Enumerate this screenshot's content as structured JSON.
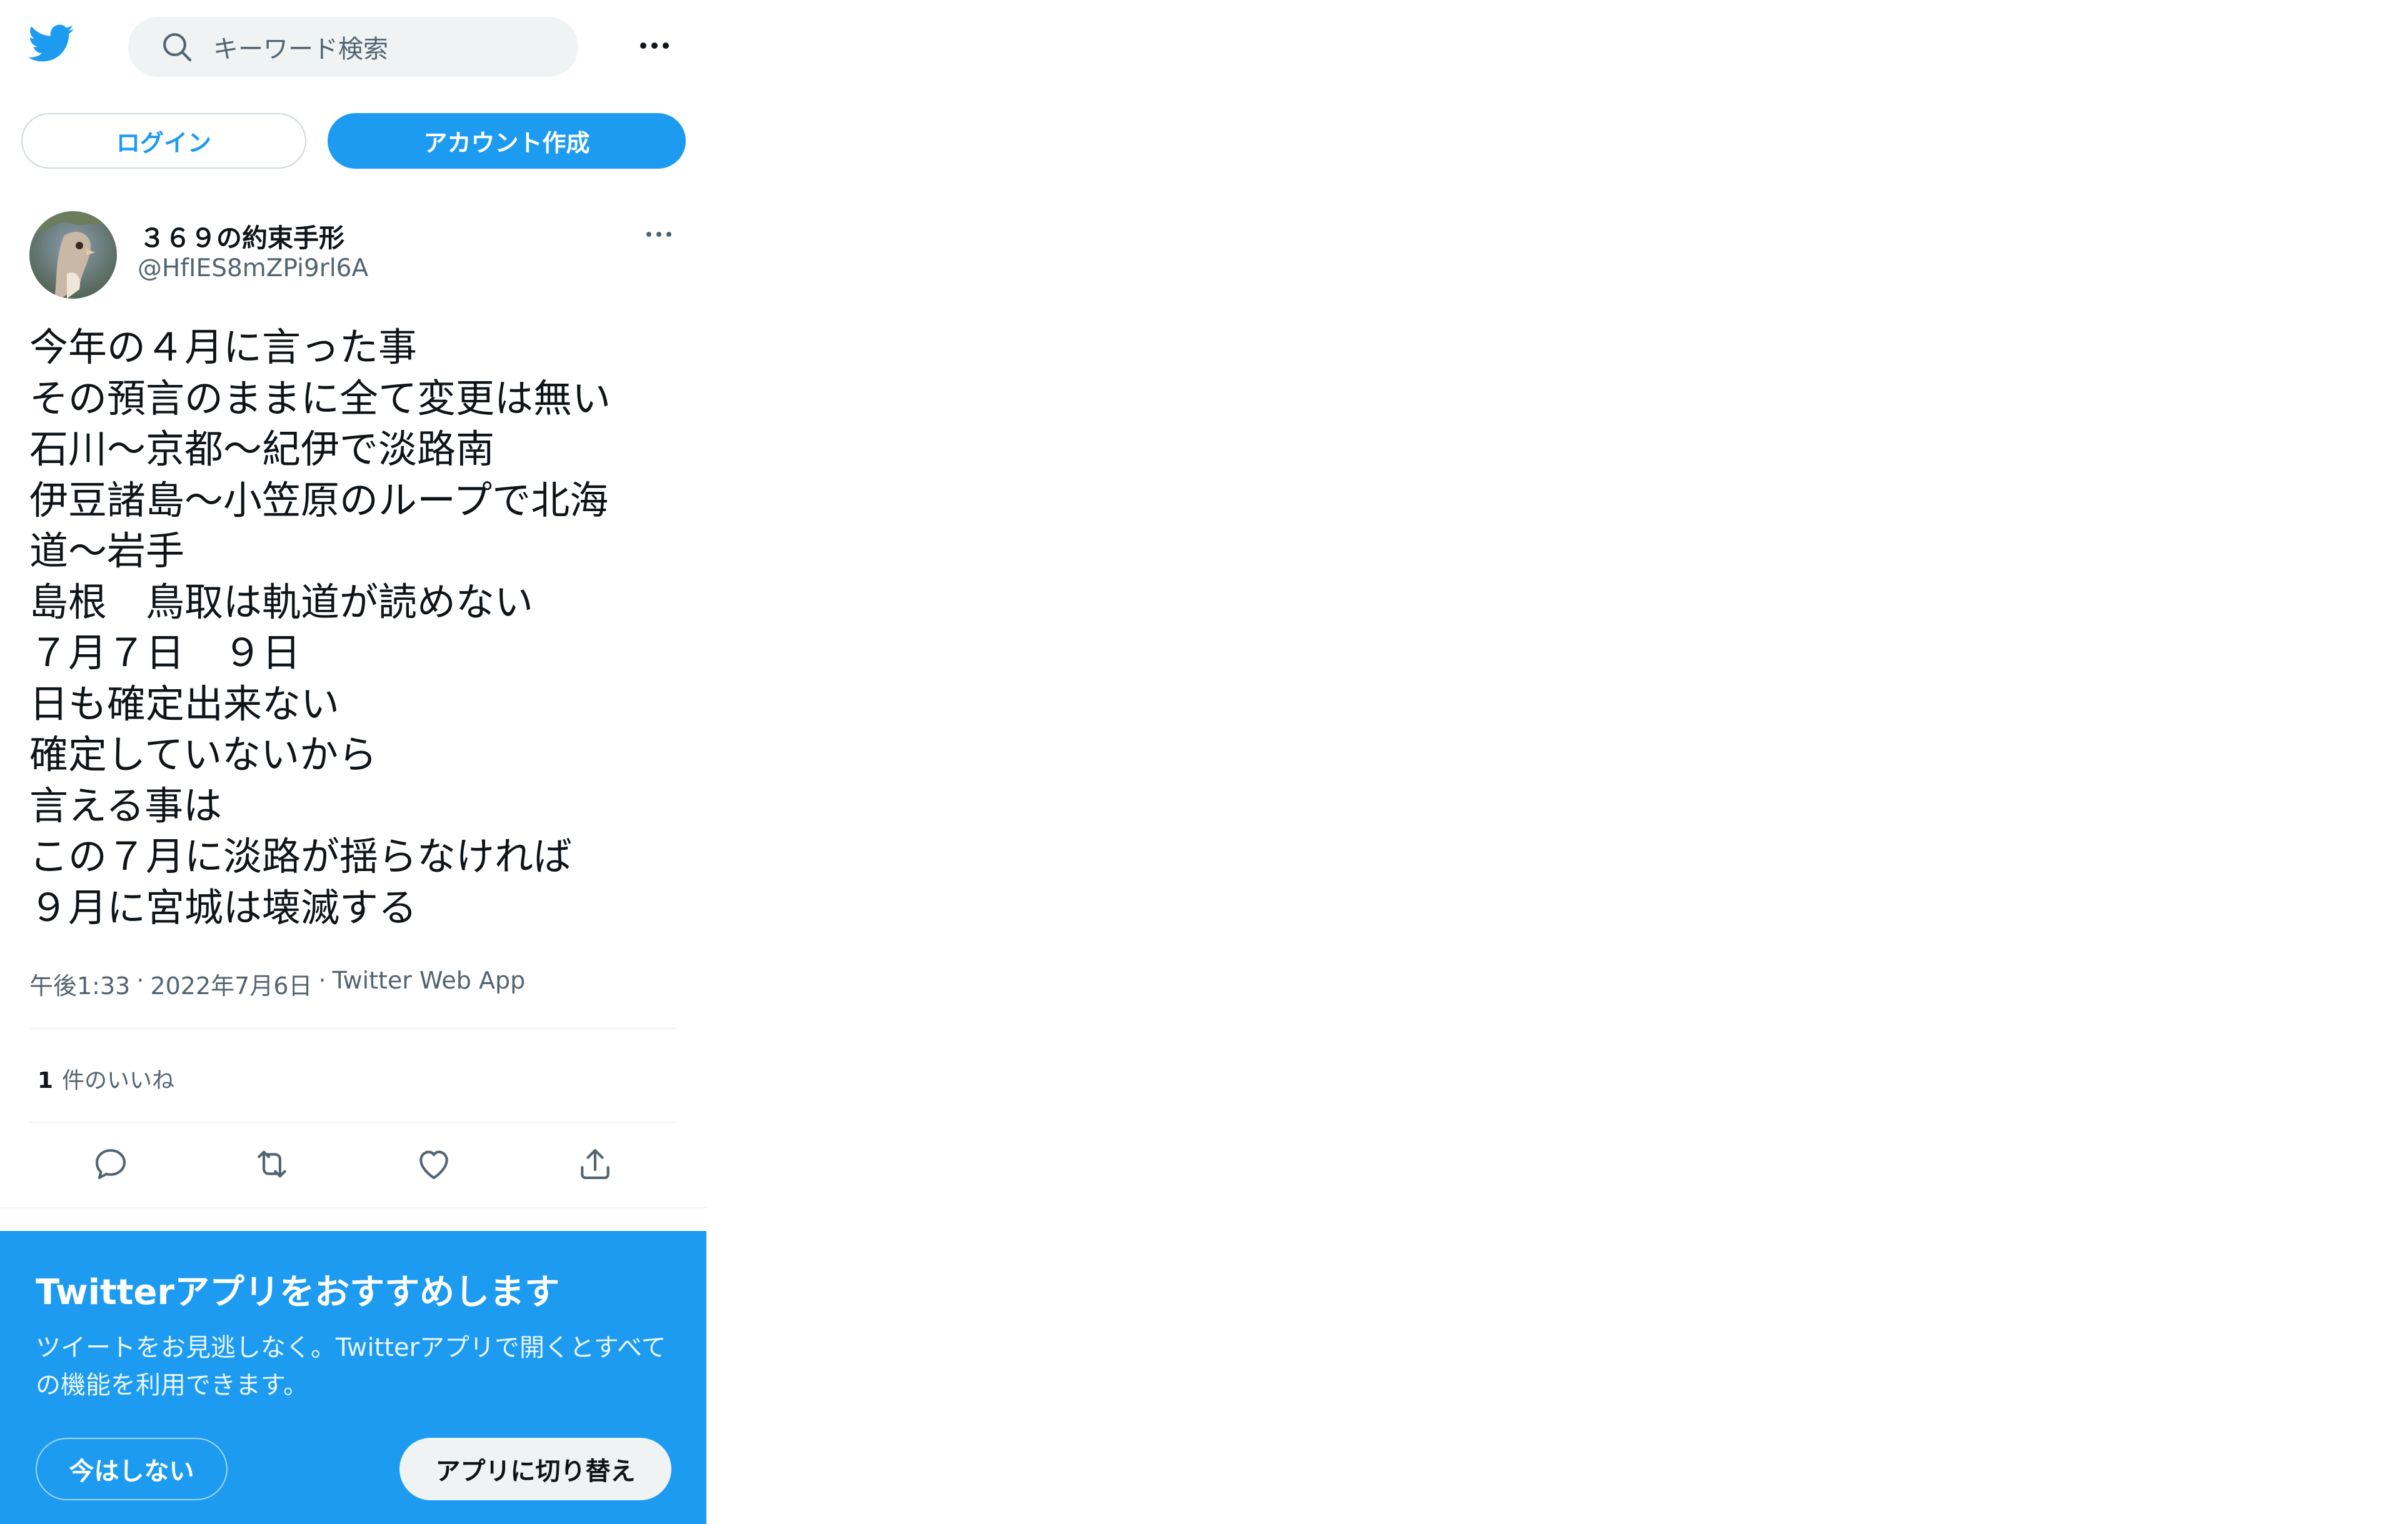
{
  "header": {
    "search_placeholder": "キーワード検索"
  },
  "auth": {
    "login_label": "ログイン",
    "signup_label": "アカウント作成"
  },
  "tweet": {
    "display_name": "３６９の約束手形",
    "handle": "@HfIES8mZPi9rl6A",
    "lines": [
      "今年の４月に言った事",
      "その預言のままに全て変更は無い",
      "石川～京都～紀伊で淡路南",
      "伊豆諸島～小笠原のループで北海",
      "道～岩手",
      "島根　鳥取は軌道が読めない",
      "７月７日　９日",
      "日も確定出来ない",
      "確定していないから",
      "言える事は",
      "この７月に淡路が揺らなければ",
      "９月に宮城は壊滅する"
    ],
    "time": "午後1:33",
    "date": "2022年7月6日",
    "source": "Twitter Web App",
    "separator": "·",
    "likes_count": "1",
    "likes_label": "件のいいね"
  },
  "actions": {
    "icons": [
      "reply-icon",
      "retweet-icon",
      "like-icon",
      "share-icon"
    ]
  },
  "promo": {
    "title": "Twitterアプリをおすすめします",
    "body": "ツイートをお見逃しなく。Twitterアプリで開くとすべての機能を利用できます。",
    "not_now_label": "今はしない",
    "switch_label": "アプリに切り替え"
  },
  "colors": {
    "brand": "#1d9bf0",
    "text": "#0f1419",
    "secondary": "#536471",
    "divider": "#eff3f4"
  }
}
